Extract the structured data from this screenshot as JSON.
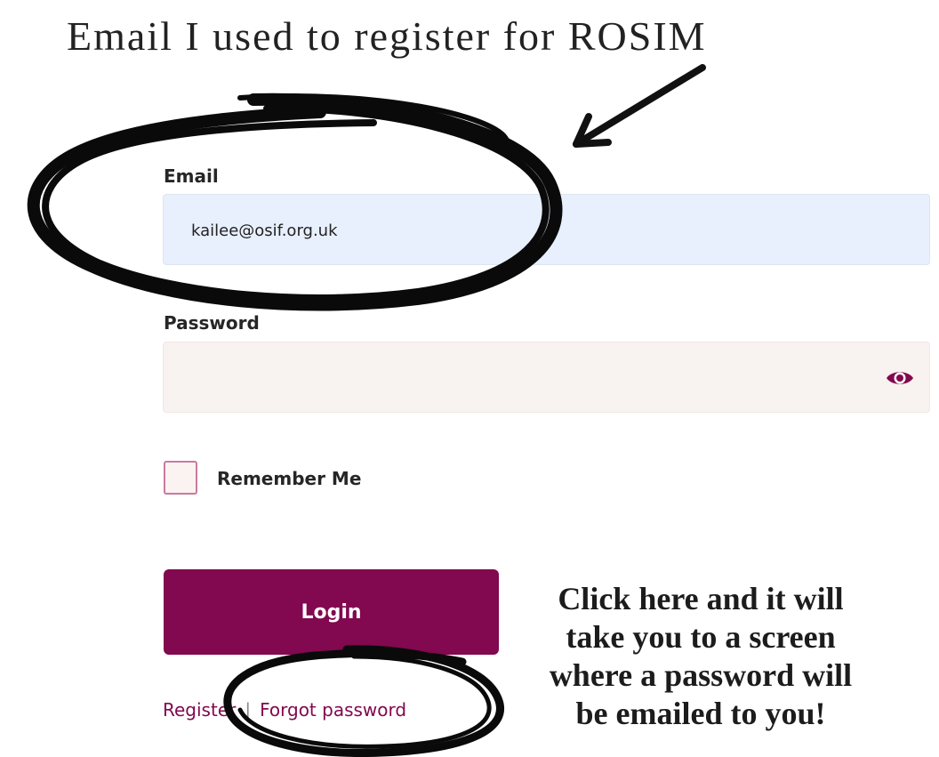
{
  "annotations": {
    "title": "Email I used to register for ROSIM",
    "note_lines": [
      "Click here and it will",
      "take you to a screen",
      "where a password will",
      "be emailed to you!"
    ]
  },
  "form": {
    "email_label": "Email",
    "email_value": "kailee@osif.org.uk",
    "password_label": "Password",
    "password_value": "",
    "remember_label": "Remember Me",
    "remember_checked": false,
    "login_label": "Login"
  },
  "links": {
    "register": "Register",
    "separator": "|",
    "forgot_password": "Forgot password"
  },
  "icons": {
    "eye": "eye-icon"
  },
  "colors": {
    "brand": "#82084f",
    "email_bg": "#e8f0fe",
    "password_bg": "#f8f2f0"
  }
}
